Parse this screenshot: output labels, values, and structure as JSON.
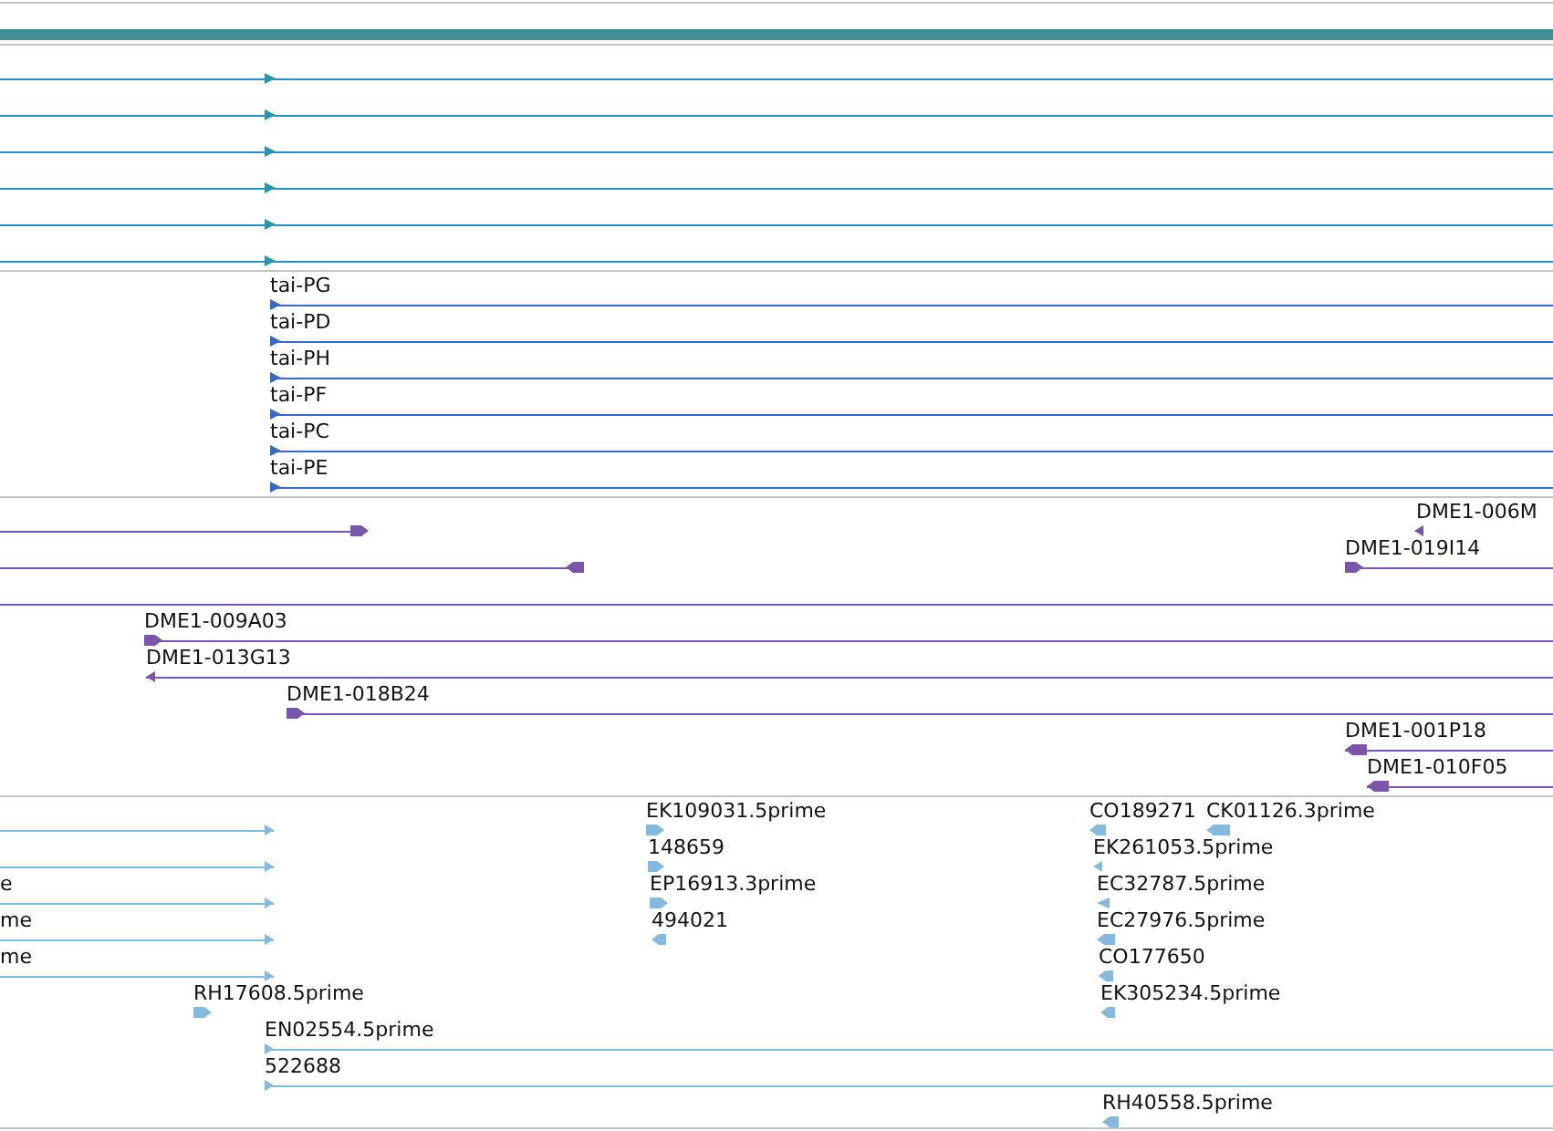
{
  "tracks": [
    {
      "color": "#2a93b0",
      "features": [
        {
          "kind": "span",
          "reverse": false
        },
        {
          "kind": "span",
          "reverse": false
        },
        {
          "kind": "span",
          "reverse": false
        },
        {
          "kind": "span",
          "reverse": false
        },
        {
          "kind": "span",
          "reverse": false
        },
        {
          "kind": "span",
          "reverse": false
        }
      ]
    },
    {
      "color": "#3a6ac0",
      "features": [
        {
          "label": "tai-PG",
          "kind": "span",
          "reverse": false
        },
        {
          "label": "tai-PD",
          "kind": "span",
          "reverse": false
        },
        {
          "label": "tai-PH",
          "kind": "span",
          "reverse": false
        },
        {
          "label": "tai-PF",
          "kind": "span",
          "reverse": false
        },
        {
          "label": "tai-PC",
          "kind": "span",
          "reverse": false
        },
        {
          "label": "tai-PE",
          "kind": "span",
          "reverse": false
        }
      ]
    },
    {
      "color": "#7a56a8",
      "features": [
        {
          "kind": "span",
          "reverse": false
        },
        {
          "label": "DME1-006M",
          "kind": "block",
          "reverse": true
        },
        {
          "kind": "span",
          "reverse": true
        },
        {
          "label": "DME1-019I14",
          "kind": "span",
          "reverse": false
        },
        {
          "kind": "span"
        },
        {
          "label": "DME1-009A03",
          "kind": "span",
          "reverse": false
        },
        {
          "label": "DME1-013G13",
          "kind": "span",
          "reverse": true
        },
        {
          "label": "DME1-018B24",
          "kind": "span",
          "reverse": false
        },
        {
          "label": "DME1-001P18",
          "kind": "span",
          "reverse": true
        },
        {
          "label": "DME1-010F05",
          "kind": "span",
          "reverse": true
        }
      ]
    },
    {
      "color": "#86b9de",
      "features": [
        {
          "kind": "span",
          "reverse": false
        },
        {
          "label": "EK109031.5prime",
          "kind": "block",
          "reverse": false
        },
        {
          "label": "CO189271",
          "kind": "block",
          "reverse": true
        },
        {
          "label": "CK01126.3prime",
          "kind": "block",
          "reverse": true
        },
        {
          "kind": "span",
          "reverse": false
        },
        {
          "label": "148659",
          "kind": "block",
          "reverse": false
        },
        {
          "label": "EK261053.5prime",
          "kind": "block",
          "reverse": true
        },
        {
          "label": "e",
          "kind": "span",
          "reverse": false
        },
        {
          "label": "EP16913.3prime",
          "kind": "block",
          "reverse": false
        },
        {
          "label": "EC32787.5prime",
          "kind": "block",
          "reverse": true
        },
        {
          "label": "me",
          "kind": "span",
          "reverse": false
        },
        {
          "label": "494021",
          "kind": "block",
          "reverse": true
        },
        {
          "label": "EC27976.5prime",
          "kind": "block",
          "reverse": true
        },
        {
          "label": "me",
          "kind": "span",
          "reverse": false
        },
        {
          "label": "CO177650",
          "kind": "block",
          "reverse": true
        },
        {
          "label": "RH17608.5prime",
          "kind": "block",
          "reverse": false
        },
        {
          "label": "EK305234.5prime",
          "kind": "block",
          "reverse": true
        },
        {
          "label": "EN02554.5prime",
          "kind": "span",
          "reverse": false
        },
        {
          "label": "522688",
          "kind": "span",
          "reverse": false
        },
        {
          "label": "RH40558.5prime",
          "kind": "block",
          "reverse": true
        }
      ]
    }
  ]
}
